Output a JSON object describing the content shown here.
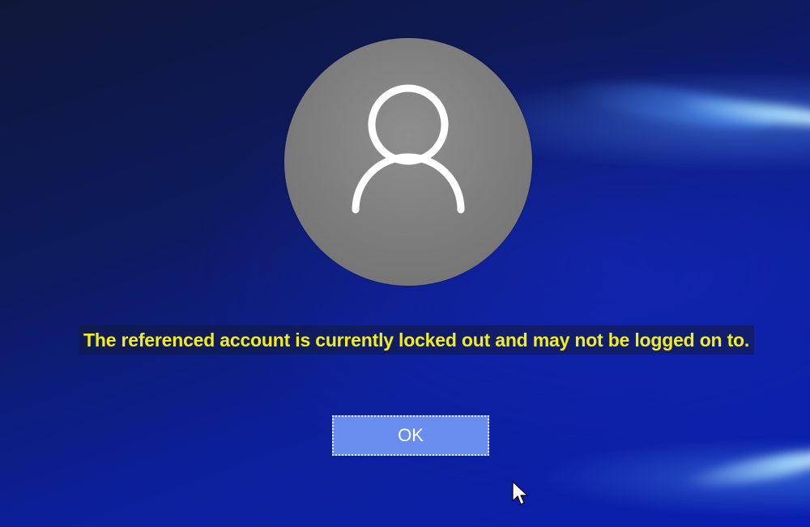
{
  "lock_screen": {
    "user_icon": "user-silhouette-icon",
    "message": "The referenced account is currently locked out and may not be logged on to.",
    "ok_button_label": "OK",
    "colors": {
      "message_text": "#f2ee1c",
      "button_background": "#6a8df0",
      "avatar_background": "#7c7c7c"
    }
  },
  "cursor_icon": "mouse-pointer-icon"
}
